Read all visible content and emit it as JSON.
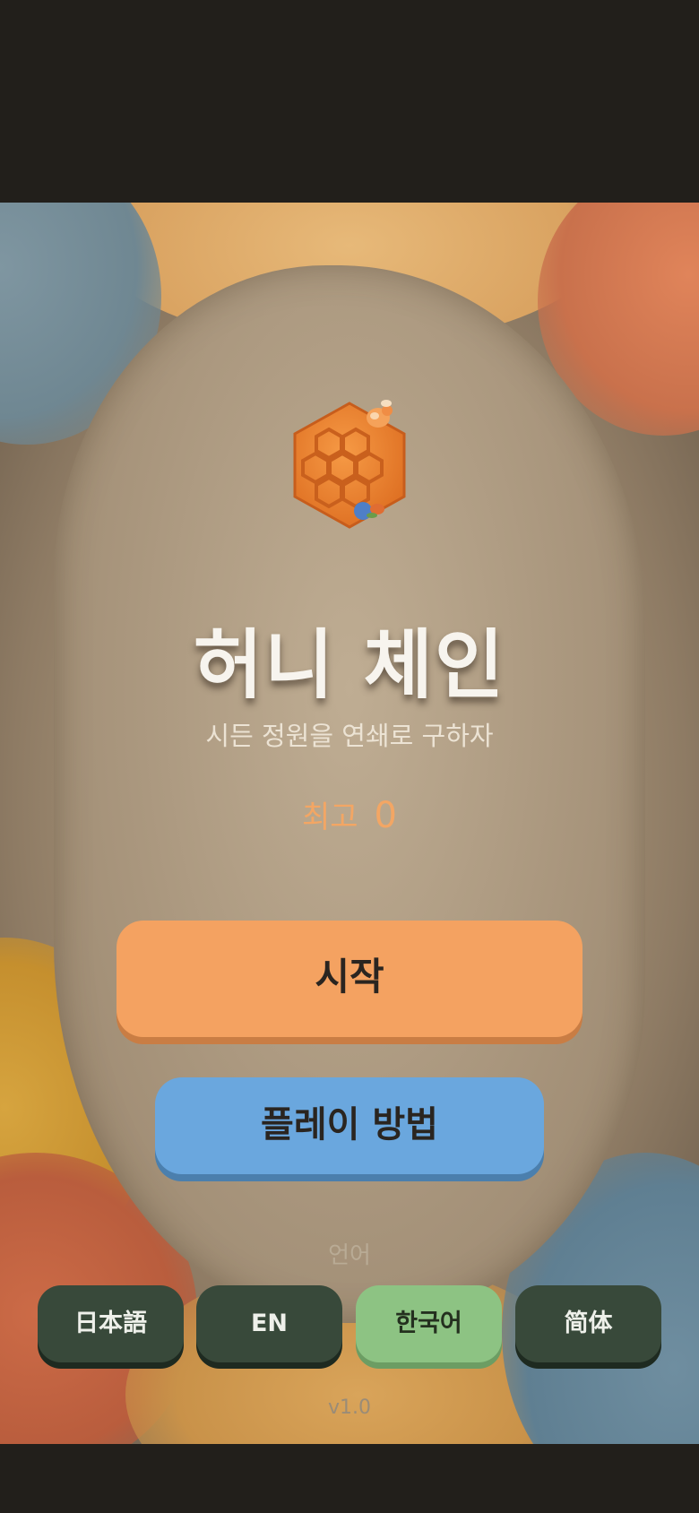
{
  "title": "허니 체인",
  "subtitle": "시든 정원을 연쇄로 구하자",
  "best": {
    "label": "최고",
    "value": "0"
  },
  "buttons": {
    "start": "시작",
    "how_to_play": "플레이 방법"
  },
  "language": {
    "label": "언어",
    "options": [
      "日本語",
      "EN",
      "한국어",
      "简体"
    ],
    "selected": "한국어"
  },
  "version": "v1.0",
  "colors": {
    "start_button": "#f4a261",
    "how_to_button": "#6aa7de",
    "lang_button": "#38493a",
    "lang_active": "#8dc383",
    "best_text": "#f3a664"
  },
  "icons": {
    "logo": "honeycomb-with-bee-icon"
  }
}
